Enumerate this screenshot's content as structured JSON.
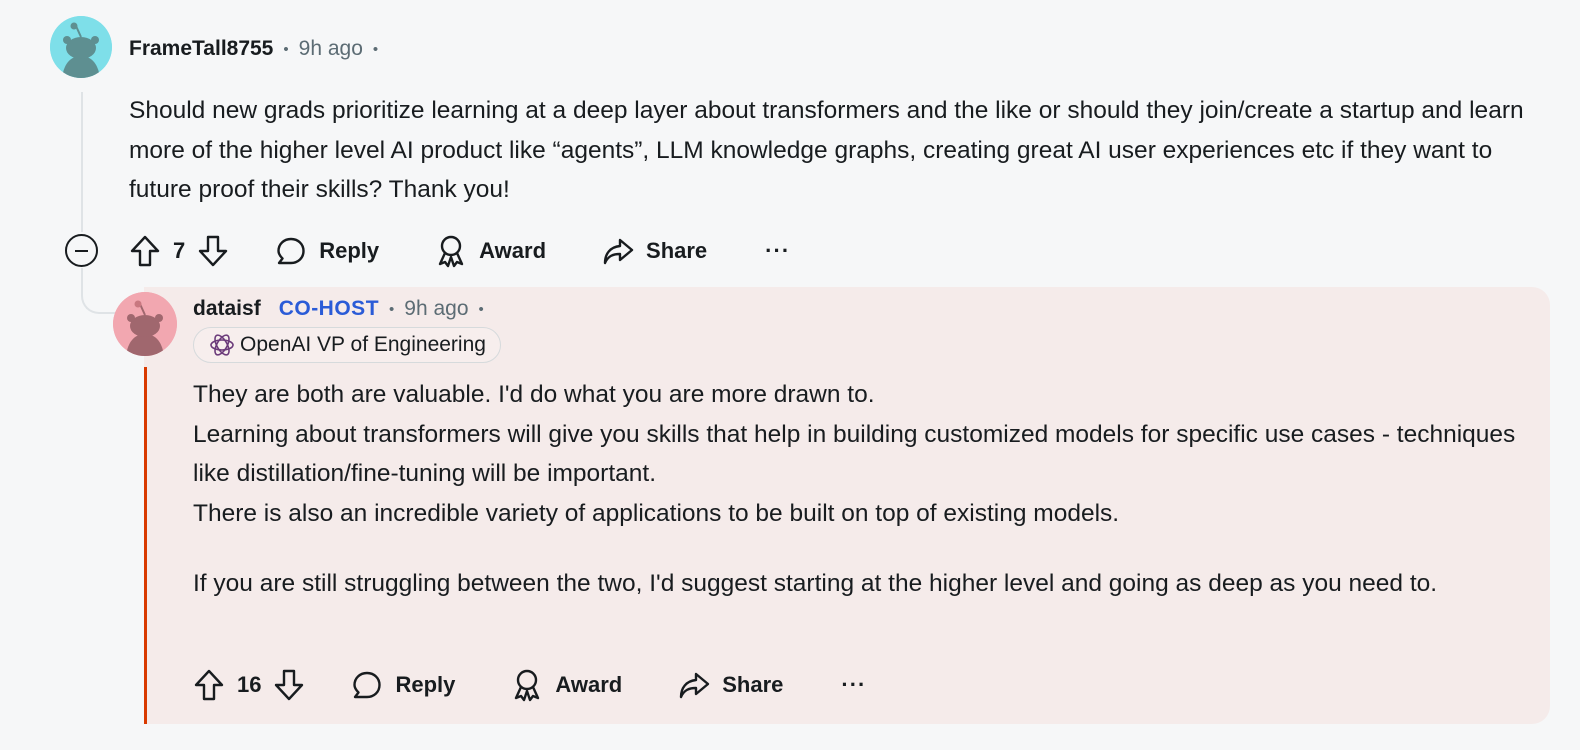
{
  "comment": {
    "author": "FrameTall8755",
    "separator": "•",
    "time": "9h ago",
    "body": "Should new grads prioritize learning at a deep layer about transformers and the like or should they join/create a startup and learn more of the higher level AI product like “agents”, LLM knowledge graphs, creating great AI user experiences etc if they want to future proof their skills? Thank you!",
    "score": "7",
    "actions": {
      "reply": "Reply",
      "award": "Award",
      "share": "Share",
      "more": "···"
    }
  },
  "reply": {
    "author": "dataisf",
    "badge": "CO-HOST",
    "separator": "•",
    "time": "9h ago",
    "flair": "OpenAI VP of Engineering",
    "paragraphs": [
      "They are both are valuable. I'd do what you are more drawn to.",
      "Learning about transformers will give you skills that help in building customized models for specific use cases - techniques like distillation/fine-tuning will be important.",
      "There is also an incredible variety of applications to be built on top of existing models.",
      "If you are still struggling between the two, I'd suggest starting at the higher level and going as deep as you need to."
    ],
    "score": "16",
    "actions": {
      "reply": "Reply",
      "award": "Award",
      "share": "Share",
      "more": "···"
    }
  },
  "colors": {
    "background": "#f6f7f8",
    "reply_card": "#f5ebea",
    "accent_line": "#d93a00",
    "cohost": "#2a5bd7",
    "avatar_1": "#7edfe9",
    "avatar_2": "#f2a7b0"
  },
  "icons": [
    "snoo-avatar-icon",
    "upvote-icon",
    "downvote-icon",
    "comment-icon",
    "award-icon",
    "share-icon",
    "collapse-icon",
    "openai-logo-icon"
  ]
}
